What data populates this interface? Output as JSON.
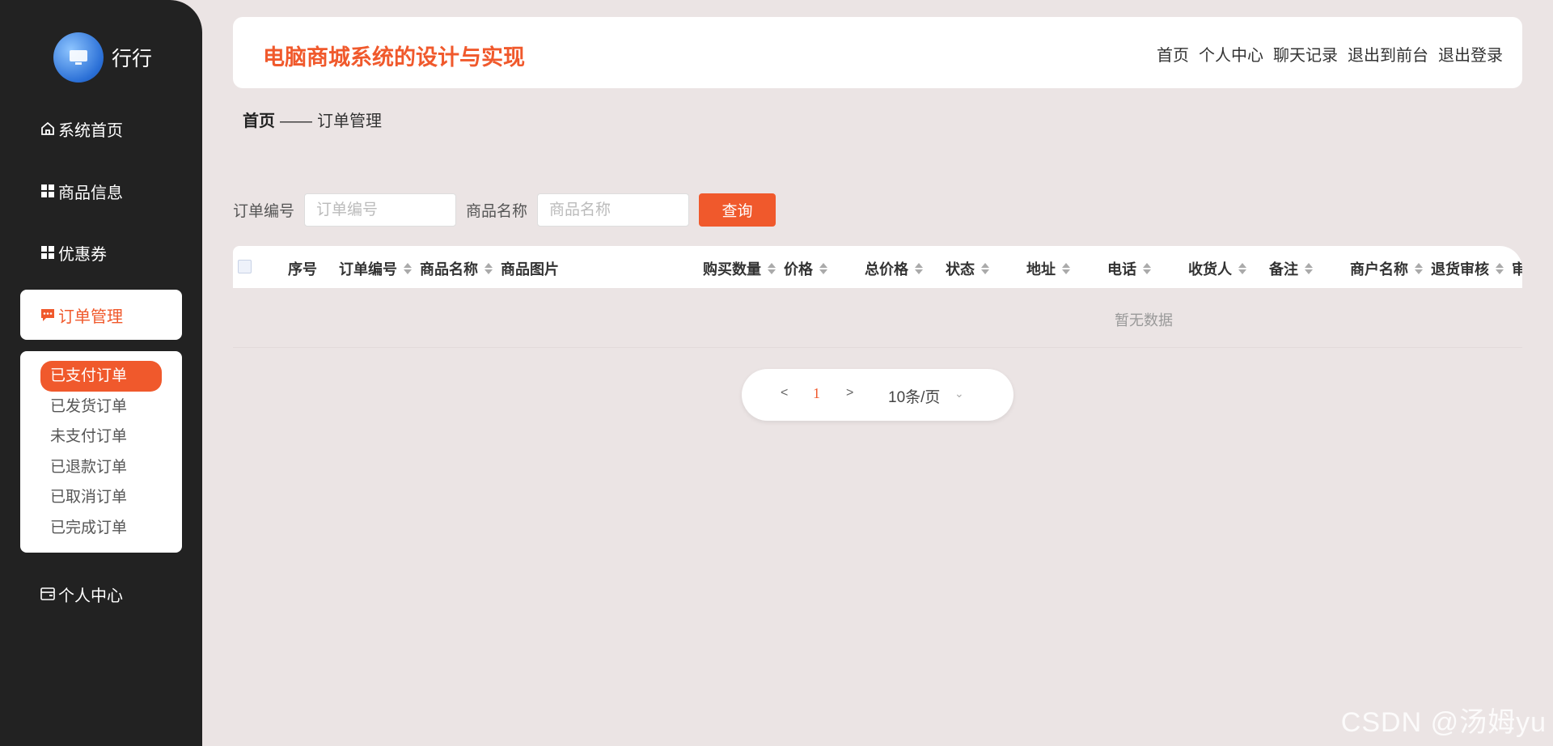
{
  "sidebar": {
    "brand_name": "行行",
    "items": [
      {
        "label": "系统首页",
        "icon": "home-icon"
      },
      {
        "label": "商品信息",
        "icon": "grid-icon"
      },
      {
        "label": "优惠券",
        "icon": "grid-icon"
      },
      {
        "label": "订单管理",
        "icon": "chat-icon"
      },
      {
        "label": "个人中心",
        "icon": "wallet-icon"
      }
    ],
    "submenu": [
      "已支付订单",
      "已发货订单",
      "未支付订单",
      "已退款订单",
      "已取消订单",
      "已完成订单"
    ]
  },
  "header": {
    "title": "电脑商城系统的设计与实现",
    "links": [
      "首页",
      "个人中心",
      "聊天记录",
      "退出到前台",
      "退出登录"
    ]
  },
  "breadcrumb": {
    "home": "首页",
    "separator": "——",
    "current": "订单管理"
  },
  "search": {
    "order_no_label": "订单编号",
    "order_no_placeholder": "订单编号",
    "product_name_label": "商品名称",
    "product_name_placeholder": "商品名称",
    "query_button": "查询"
  },
  "table": {
    "columns": [
      "序号",
      "订单编号",
      "商品名称",
      "商品图片",
      "购买数量",
      "价格",
      "总价格",
      "状态",
      "地址",
      "电话",
      "收货人",
      "备注",
      "商户名称",
      "退货审核",
      "审"
    ],
    "empty_text": "暂无数据"
  },
  "pagination": {
    "prev": "<",
    "current_page": "1",
    "next": ">",
    "page_size": "10条/页"
  },
  "watermark": "CSDN @汤姆yu",
  "colors": {
    "accent": "#f0592c",
    "sidebar_bg": "#222222",
    "page_bg": "#ebe4e4"
  }
}
